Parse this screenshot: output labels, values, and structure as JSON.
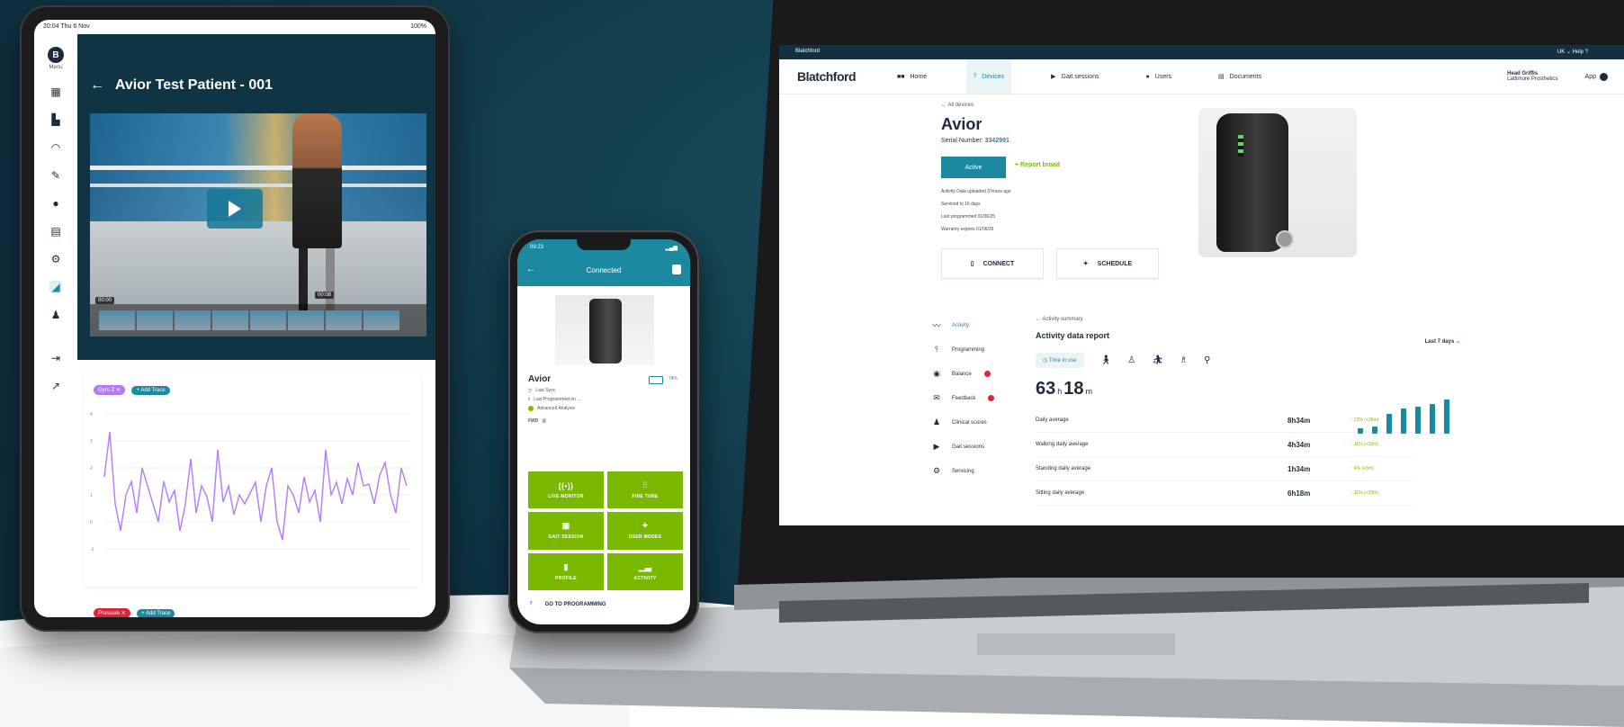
{
  "tablet": {
    "status_time": "20:04  Thu 6 Nov",
    "status_battery": "100%",
    "menu_avatar": "B",
    "menu_label": "Menu",
    "title": "Avior Test Patient - 001",
    "back_glyph": "←",
    "video_time_left": "00:00",
    "video_time_mid": "00:08",
    "chips_top": [
      "Gyro Z ✕",
      "+ Add Trace"
    ],
    "chips_bottom": [
      "Pressure ✕",
      "+ Add Trace"
    ],
    "chart_line_color": "#b47cf0"
  },
  "phone": {
    "status_time": "09:23",
    "title": "Connected",
    "device_name": "Avior",
    "battery_pct": "74%",
    "info_rows": [
      "Last Sync",
      "Last Programmed on ...",
      "Advanced Analysis"
    ],
    "fwd_label": "FWD",
    "tiles": [
      {
        "icon": "((•))",
        "label": "LIVE MONITOR"
      },
      {
        "icon": "⫶⫶",
        "label": "FINE TUNE"
      },
      {
        "icon": "▣",
        "label": "GAIT SESSION"
      },
      {
        "icon": "✦",
        "label": "USER MODES"
      },
      {
        "icon": "▮",
        "label": "PROFILE"
      },
      {
        "icon": "▁▃",
        "label": "ACTIVITY"
      }
    ],
    "footer_label": "GO TO PROGRAMMING"
  },
  "laptop": {
    "topbar_brand": "Blatchford",
    "topbar_right": "UK  ⌄    Help  ?",
    "logo": "Blatchford",
    "nav": [
      {
        "label": "Home",
        "icon": "■■"
      },
      {
        "label": "Devices",
        "icon": "⫯"
      },
      {
        "label": "Gait sessions",
        "icon": "▶"
      },
      {
        "label": "Users",
        "icon": "●"
      },
      {
        "label": "Documents",
        "icon": "▤"
      }
    ],
    "user_name": "Head Griffis",
    "user_sub": "Lattimore Prosthetics",
    "app_label": "App",
    "crumb": "All devices",
    "device": "Avior",
    "serial_label": "Serial Number:",
    "serial": "3342991",
    "status": "Active",
    "report_link": "+ Report broad",
    "meta": [
      "Activity Data uploaded 3 hours ago",
      "Serviced in 16 days",
      "Last programmed 01/06/25",
      "Warranty expires 01/06/26"
    ],
    "btn_connect": "CONNECT",
    "btn_schedule": "SCHEDULE",
    "side": [
      {
        "label": "Activity",
        "icon": "〰",
        "badge": false
      },
      {
        "label": "Programming",
        "icon": "⫯",
        "badge": false
      },
      {
        "label": "Balance",
        "icon": "◉",
        "badge": true
      },
      {
        "label": "Feedback",
        "icon": "✉",
        "badge": true
      },
      {
        "label": "Clinical scores",
        "icon": "♟",
        "badge": false
      },
      {
        "label": "Gait sessions",
        "icon": "▶",
        "badge": false
      },
      {
        "label": "Servicing",
        "icon": "⚙",
        "badge": false
      }
    ],
    "activity_crumb": "Activity summary",
    "activity_title": "Activity data report",
    "period": "Last 7 days",
    "tab_active": "Time in use",
    "total_hours": "63",
    "total_minutes": "18",
    "unit_h": "h",
    "unit_m": "m",
    "rows": [
      {
        "label": "Daily average",
        "value": "8h34m",
        "delta": "↑ 23% (+35m)"
      },
      {
        "label": "Walking daily average",
        "value": "4h34m",
        "delta": "↑ 11% (+32m)"
      },
      {
        "label": "Standing daily average",
        "value": "1h34m",
        "delta": "↑ 4% (+5m)"
      },
      {
        "label": "Sitting daily average",
        "value": "6h18m",
        "delta": "↑ 11% (+33m)"
      }
    ],
    "bar_levels": [
      0.15,
      0.2,
      0.55,
      0.7,
      0.75,
      0.82,
      0.95
    ]
  }
}
